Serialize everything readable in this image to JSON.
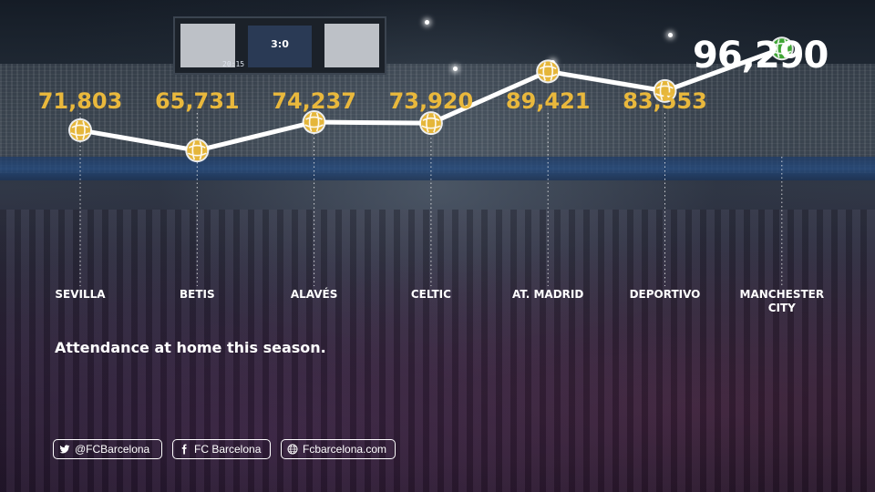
{
  "chart_data": {
    "type": "line",
    "title": "",
    "subtitle": "Attendance at home this season.",
    "highlight_value": "96,290",
    "categories": [
      "SEVILLA",
      "BETIS",
      "ALAVÉS",
      "CELTIC",
      "AT. MADRID",
      "DEPORTIVO",
      "MANCHESTER CITY"
    ],
    "category_lines": [
      [
        "SEVILLA"
      ],
      [
        "BETIS"
      ],
      [
        "ALAVÉS"
      ],
      [
        "CELTIC"
      ],
      [
        "AT. MADRID"
      ],
      [
        "DEPORTIVO"
      ],
      [
        "MANCHESTER",
        "CITY"
      ]
    ],
    "values": [
      71803,
      65731,
      74237,
      73920,
      89421,
      83553,
      96290
    ],
    "value_labels": [
      "71,803",
      "65,731",
      "74,237",
      "73,920",
      "89,421",
      "83,553",
      ""
    ],
    "ylim": [
      50000,
      100000
    ],
    "grid": false,
    "colors": {
      "line": "#ffffff",
      "marker": "#e5b63a",
      "highlight_marker": "#3fa535",
      "value_label": "#e9b83c"
    }
  },
  "scoreboard": {
    "score": "3:0",
    "clock": "20:15"
  },
  "socials": [
    {
      "icon": "twitter-icon",
      "label": "@FCBarcelona"
    },
    {
      "icon": "facebook-icon",
      "label": "FC Barcelona"
    },
    {
      "icon": "globe-icon",
      "label": "Fcbarcelona.com"
    }
  ]
}
